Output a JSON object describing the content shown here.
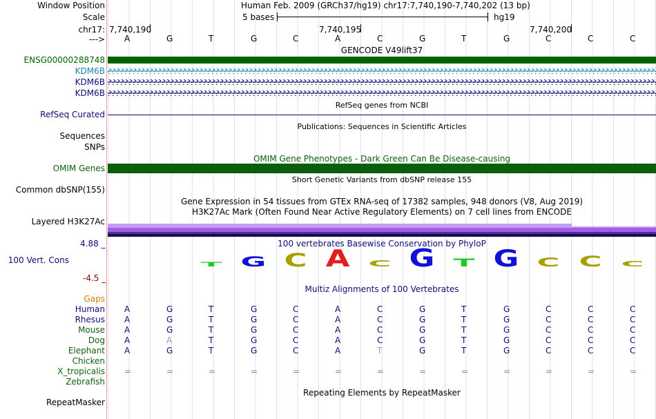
{
  "header": {
    "window_position_label": "Window Position",
    "window_position_value": "Human Feb. 2009 (GRCh37/hg19)   chr17:7,740,190-7,740,202 (13 bp)",
    "scale_label": "Scale",
    "scale_value": "5 bases",
    "scale_assembly": "hg19",
    "chrom_label": "chr17:",
    "arrow_label": "--->",
    "position_ticks": [
      "7,740,190",
      "7,740,195",
      "7,740,200"
    ]
  },
  "sequence": [
    "A",
    "G",
    "T",
    "G",
    "C",
    "A",
    "C",
    "G",
    "T",
    "G",
    "C",
    "C",
    "C"
  ],
  "tracks": {
    "gencode_title": "GENCODE V49lift37",
    "gencode_items": [
      "ENSG00000288748",
      "KDM6B",
      "KDM6B",
      "KDM6B"
    ],
    "refseq_title": "RefSeq genes from NCBI",
    "refseq_label": "RefSeq Curated",
    "pubs_title": "Publications: Sequences in Scientific Articles",
    "sequences_label": "Sequences",
    "snps_label": "SNPs",
    "omim_title": "OMIM Gene Phenotypes - Dark Green Can Be Disease-causing",
    "omim_label": "OMIM Genes",
    "dbsnp_title": "Short Genetic Variants from dbSNP release 155",
    "dbsnp_label": "Common dbSNP(155)",
    "gtex_title": "Gene Expression in 54 tissues from GTEx RNA-seq of 17382 samples, 948 donors (V8, Aug 2019)",
    "h3k27_title": "H3K27Ac Mark (Often Found Near Active Regulatory Elements) on 7 cell lines from ENCODE",
    "h3k27_label": "Layered H3K27Ac",
    "cons_top": "4.88 _",
    "cons_title": "100 vertebrates Basewise Conservation by PhyloP",
    "cons_label": "100 Vert. Cons",
    "cons_bottom": "-4.5 _",
    "multiz_title": "Multiz Alignments of 100 Vertebrates",
    "gaps_label": "Gaps",
    "repeat_title": "Repeating Elements by RepeatMasker",
    "repeat_label": "RepeatMasker"
  },
  "phylop_letters": [
    "T",
    "G",
    "C",
    "A",
    "C",
    "G",
    "T",
    "G",
    "C",
    "C",
    "C"
  ],
  "species": [
    {
      "name": "Human",
      "bases": [
        "A",
        "G",
        "T",
        "G",
        "C",
        "A",
        "C",
        "G",
        "T",
        "G",
        "C",
        "C",
        "C"
      ]
    },
    {
      "name": "Rhesus",
      "bases": [
        "A",
        "G",
        "T",
        "G",
        "C",
        "A",
        "C",
        "G",
        "T",
        "G",
        "C",
        "C",
        "C"
      ]
    },
    {
      "name": "Mouse",
      "bases": [
        "A",
        "G",
        "T",
        "G",
        "C",
        "A",
        "C",
        "G",
        "T",
        "G",
        "C",
        "C",
        "C"
      ]
    },
    {
      "name": "Dog",
      "bases": [
        "A",
        "A",
        "T",
        "G",
        "C",
        "A",
        "C",
        "G",
        "T",
        "G",
        "C",
        "C",
        "C"
      ]
    },
    {
      "name": "Elephant",
      "bases": [
        "A",
        "G",
        "T",
        "G",
        "C",
        "A",
        "T",
        "G",
        "T",
        "G",
        "C",
        "C",
        "C"
      ]
    },
    {
      "name": "Chicken",
      "bases": [
        "",
        "",
        "",
        "",
        "",
        "",
        "",
        "",
        "",
        "",
        "",
        "",
        ""
      ]
    },
    {
      "name": "X_tropicalis",
      "bases": [
        "=",
        "=",
        "=",
        "=",
        "=",
        "=",
        "=",
        "=",
        "=",
        "=",
        "=",
        "=",
        "="
      ]
    },
    {
      "name": "Zebrafish",
      "bases": [
        "",
        "",
        "",
        "",
        "",
        "",
        "",
        "",
        "",
        "",
        "",
        "",
        ""
      ]
    }
  ],
  "colors": {
    "gencode_green": "#006400",
    "kdm6b_blue": "#1e7fb0",
    "navy": "#0c0c78",
    "omim_green": "#0b5f0b",
    "h3k27_purple": "#b06ef0",
    "h3k27_dark": "#1a1a5a",
    "phylop_a": "#e02020",
    "phylop_c": "#a8a000",
    "phylop_g": "#1010d8",
    "phylop_t": "#20c820",
    "species_primate": "#0c0c78",
    "species_other": "#106010",
    "gaps_orange": "#d08000"
  }
}
